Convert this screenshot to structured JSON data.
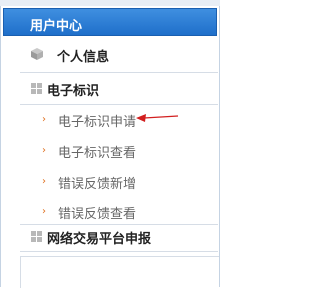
{
  "header": {
    "title": "用户中心"
  },
  "menu": {
    "personal": "个人信息",
    "eid_section": "电子标识",
    "sub_items": [
      "电子标识申请",
      "电子标识查看",
      "错误反馈新增",
      "错误反馈查看"
    ],
    "trade_section": "网络交易平台申报"
  },
  "colors": {
    "header_bg": "#2a7ad6",
    "bullet": "#e07020",
    "arrow": "#d21f1f"
  },
  "icons": {
    "personal": "cube-icon",
    "sections": "grid-icon",
    "sub": "chevron-right-icon",
    "pointer": "red-arrow-icon"
  }
}
